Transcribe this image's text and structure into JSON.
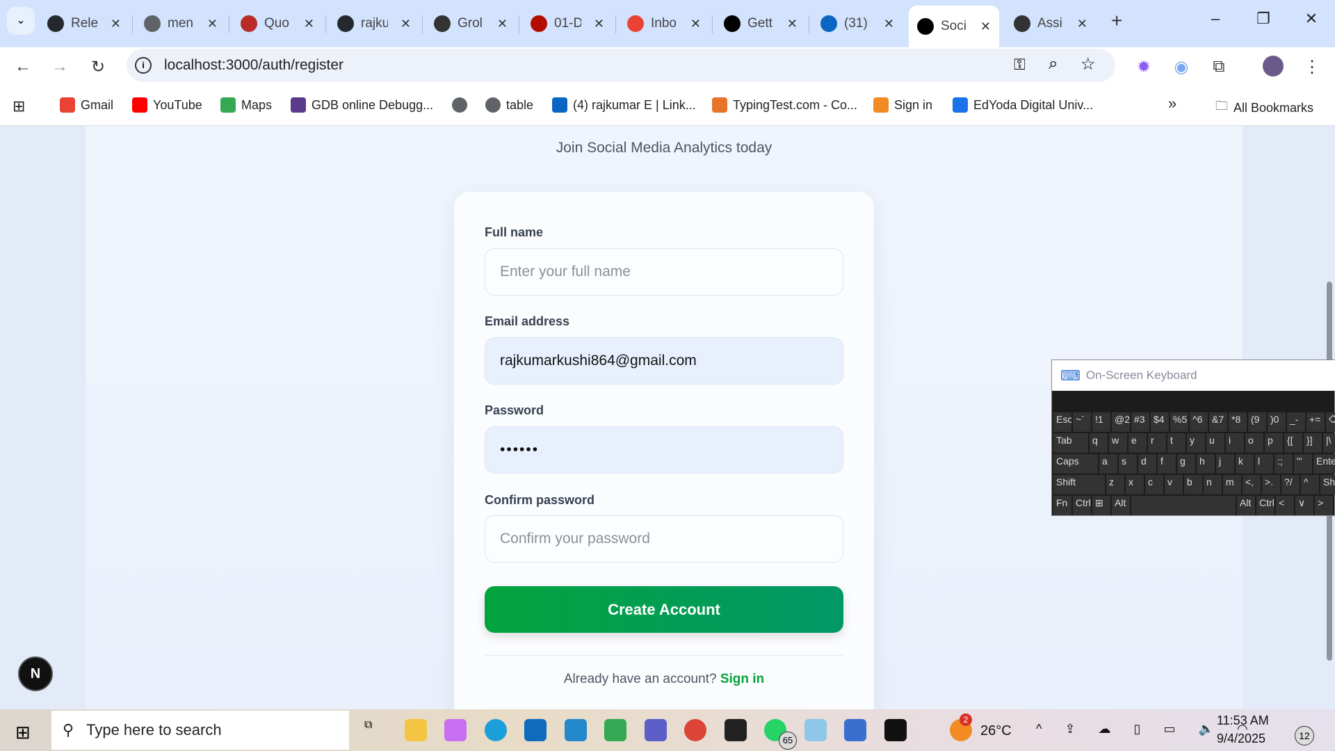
{
  "browser": {
    "tabs": [
      {
        "label": "Rele",
        "icon": "github-icon",
        "color": "#24292f"
      },
      {
        "label": "men",
        "icon": "globe-icon",
        "color": "#5f6368"
      },
      {
        "label": "Quo",
        "icon": "quora-icon",
        "color": "#b92b27"
      },
      {
        "label": "rajku",
        "icon": "github-icon",
        "color": "#24292f"
      },
      {
        "label": "Grol",
        "icon": "grok-icon",
        "color": "#333333"
      },
      {
        "label": "01-D",
        "icon": "pdf-icon",
        "color": "#b30b00"
      },
      {
        "label": "Inbo",
        "icon": "gmail-icon",
        "color": "#ea4335"
      },
      {
        "label": "Gett",
        "icon": "notion-icon",
        "color": "#000000"
      },
      {
        "label": "(31)",
        "icon": "linkedin-icon",
        "color": "#0a66c2"
      },
      {
        "label": "Soci",
        "icon": "vercel-icon",
        "color": "#000000",
        "active": true
      },
      {
        "label": "Assi",
        "icon": "openai-icon",
        "color": "#333333"
      }
    ],
    "url": "localhost:3000/auth/register",
    "bookmarks": [
      {
        "label": "Gmail",
        "icon": "gmail-icon",
        "color": "#ea4335"
      },
      {
        "label": "YouTube",
        "icon": "youtube-icon",
        "color": "#ff0000"
      },
      {
        "label": "Maps",
        "icon": "maps-icon",
        "color": "#34a853"
      },
      {
        "label": "GDB online Debugg...",
        "icon": "gdb-icon",
        "color": "#5b3a8c"
      },
      {
        "label": "",
        "icon": "globe-icon",
        "color": "#5f6368"
      },
      {
        "label": "table",
        "icon": "globe-icon",
        "color": "#5f6368"
      },
      {
        "label": "(4) rajkumar E | Link...",
        "icon": "linkedin-icon",
        "color": "#0a66c2"
      },
      {
        "label": "TypingTest.com - Co...",
        "icon": "typingtest-icon",
        "color": "#e8742c"
      },
      {
        "label": "Sign in",
        "icon": "shield-icon",
        "color": "#f28b24"
      },
      {
        "label": "EdYoda Digital Univ...",
        "icon": "edyoda-icon",
        "color": "#1a73e8"
      }
    ],
    "all_bookmarks": "All Bookmarks",
    "more": "»"
  },
  "page": {
    "subtitle": "Join Social Media Analytics today",
    "form": {
      "full_name_label": "Full name",
      "full_name_placeholder": "Enter your full name",
      "full_name_value": "",
      "email_label": "Email address",
      "email_value": "rajkumarkushi864@gmail.com",
      "password_label": "Password",
      "password_value": "••••••",
      "confirm_label": "Confirm password",
      "confirm_placeholder": "Confirm your password",
      "submit": "Create Account",
      "have_account": "Already have an account?",
      "sign_in": "Sign in"
    },
    "next_badge": "N"
  },
  "osk": {
    "title": "On-Screen Keyboard",
    "rows": [
      [
        "Esc",
        "~`",
        "!1",
        "@2",
        "#3",
        "$4",
        "%5",
        "^6",
        "&7",
        "*8",
        "(9",
        ")0",
        "_-",
        "+=",
        "⌫"
      ],
      [
        "Tab",
        "q",
        "w",
        "e",
        "r",
        "t",
        "y",
        "u",
        "i",
        "o",
        "p",
        "{[",
        "}]",
        "|\\"
      ],
      [
        "Caps",
        "a",
        "s",
        "d",
        "f",
        "g",
        "h",
        "j",
        "k",
        "l",
        ":;",
        "\"'",
        "Enter"
      ],
      [
        "Shift",
        "z",
        "x",
        "c",
        "v",
        "b",
        "n",
        "m",
        "<,",
        ">.",
        "?/",
        "^",
        "Shi"
      ],
      [
        "Fn",
        "Ctrl",
        "⊞",
        "Alt",
        " ",
        "Alt",
        "Ctrl",
        "<",
        "∨",
        ">"
      ]
    ]
  },
  "taskbar": {
    "search_placeholder": "Type here to search",
    "apps": [
      "task-view",
      "file-explorer",
      "copilot",
      "edge",
      "outlook",
      "vscode",
      "meet",
      "teams",
      "chrome",
      "terminal",
      "whatsapp",
      "notepad",
      "osk",
      "app"
    ],
    "whatsapp_badge": "65",
    "weather_badge": "2",
    "temperature": "26°C",
    "time": "11:53 AM",
    "date": "9/4/2025",
    "notifications": "12"
  }
}
